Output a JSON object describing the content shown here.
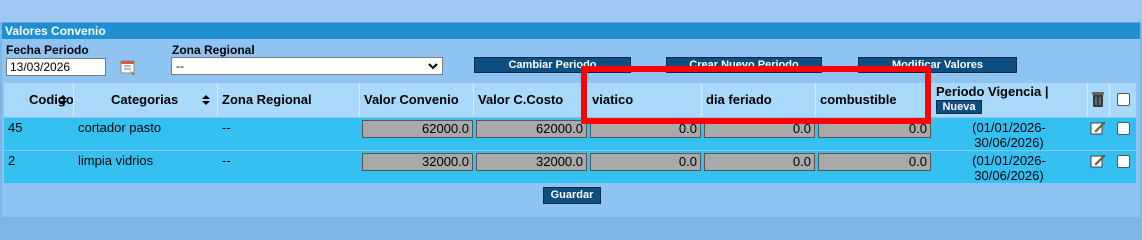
{
  "panel": {
    "title": "Valores Convenio"
  },
  "filters": {
    "fecha_label": "Fecha Periodo",
    "fecha_value": "13/03/2026",
    "zona_label": "Zona Regional",
    "zona_value": "--"
  },
  "buttons": {
    "cambiar_periodo": "Cambiar Periodo",
    "crear_nuevo_periodo": "Crear Nuevo Periodo",
    "modificar_valores": "Modificar Valores",
    "nueva": "Nueva",
    "guardar": "Guardar"
  },
  "table": {
    "headers": {
      "codigo": "Codigo",
      "categorias": "Categorias",
      "zona": "Zona Regional",
      "valor_convenio": "Valor Convenio",
      "valor_costo": "Valor C.Costo",
      "viatico": "viatico",
      "dia_feriado": "dia feriado",
      "combustible": "combustible",
      "periodo_vigencia": "Periodo Vigencia |"
    },
    "rows": [
      {
        "codigo": "45",
        "categoria": "cortador pasto",
        "zona": "--",
        "valor_convenio": "62000.0",
        "valor_costo": "62000.0",
        "viatico": "0.0",
        "dia_feriado": "0.0",
        "combustible": "0.0",
        "vigencia_line1": "(01/01/2026-",
        "vigencia_line2": "30/06/2026)"
      },
      {
        "codigo": "2",
        "categoria": "limpia vidrios",
        "zona": "--",
        "valor_convenio": "32000.0",
        "valor_costo": "32000.0",
        "viatico": "0.0",
        "dia_feriado": "0.0",
        "combustible": "0.0",
        "vigencia_line1": "(01/01/2026-",
        "vigencia_line2": "30/06/2026)"
      }
    ]
  },
  "colors": {
    "header_bg": "#a8d8fa",
    "row_bg": "#35c0f2",
    "button_bg": "#0e4f82",
    "highlight": "#ff0000"
  },
  "icons": [
    "calendar-icon",
    "chevron-down-icon",
    "sort-icon",
    "trash-icon",
    "edit-icon"
  ]
}
